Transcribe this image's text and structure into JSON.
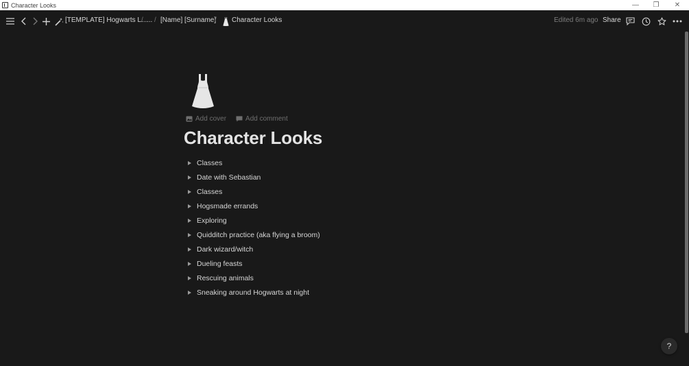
{
  "window": {
    "title": "Character Looks",
    "controls": {
      "minimize": "—",
      "maximize": "❐",
      "close": "✕"
    }
  },
  "topbar": {
    "breadcrumbs": [
      {
        "label": "[TEMPLATE] Hogwarts L...",
        "icon": "wand-sparkles-icon"
      },
      {
        "label": "..."
      },
      {
        "label": "[Name] [Surname]"
      },
      {
        "label": "Character Looks",
        "icon": "dress-icon"
      }
    ],
    "separator": "/",
    "edited": "Edited 6m ago",
    "share_label": "Share",
    "icons": [
      "menu-icon",
      "back-icon",
      "forward-icon",
      "plus-icon",
      "comments-icon",
      "history-icon",
      "star-icon",
      "more-icon"
    ]
  },
  "page": {
    "icon": "dress-icon",
    "add_cover": "Add cover",
    "add_comment": "Add comment",
    "title": "Character Looks",
    "toggles": [
      "Classes",
      "Date with Sebastian",
      "Classes",
      "Hogsmade errands",
      "Exploring",
      "Quidditch practice (aka flying a broom)",
      "Dark wizard/witch",
      "Dueling feasts",
      "Rescuing animals",
      "Sneaking around Hogwarts at night"
    ]
  },
  "help": {
    "label": "?"
  },
  "colors": {
    "background": "#191919",
    "text": "#d4d4d4",
    "muted": "#7d7d7d",
    "titlebar": "#ffffff"
  }
}
